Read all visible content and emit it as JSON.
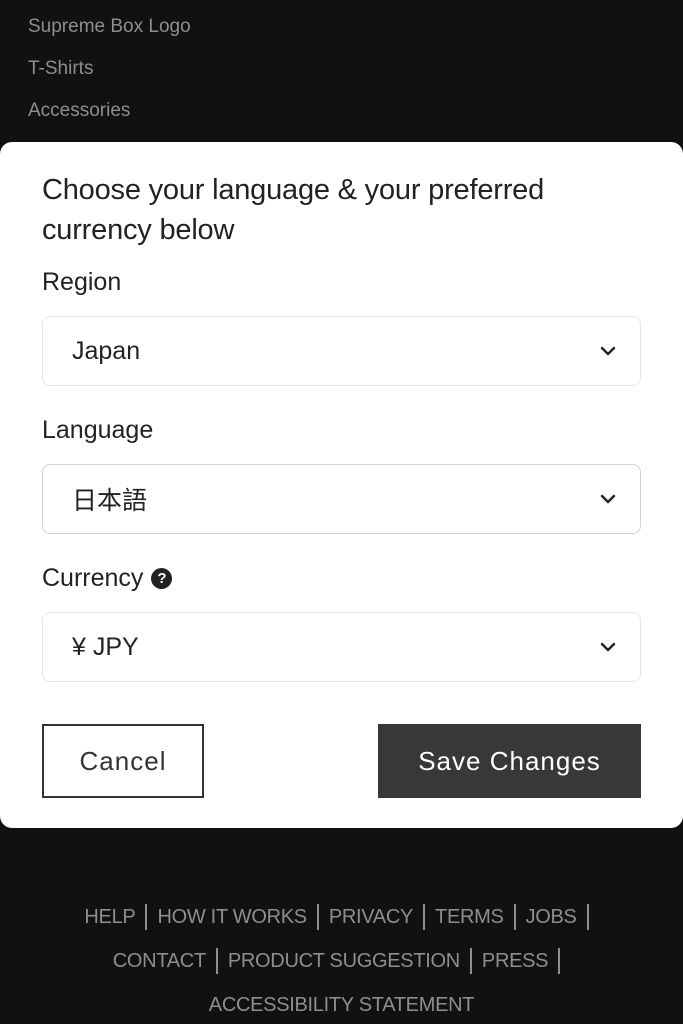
{
  "background_nav": {
    "items": [
      "Supreme Box Logo",
      "T-Shirts",
      "Accessories"
    ]
  },
  "modal": {
    "title": "Choose your language & your preferred currency below",
    "region": {
      "label": "Region",
      "value": "Japan"
    },
    "language": {
      "label": "Language",
      "value": "日本語"
    },
    "currency": {
      "label": "Currency",
      "value": "¥ JPY",
      "help_icon": "question-circle-icon"
    },
    "cancel_label": "Cancel",
    "save_label": "Save Changes"
  },
  "footer": {
    "row1": [
      "HELP",
      "HOW IT WORKS",
      "PRIVACY",
      "TERMS",
      "JOBS"
    ],
    "row2": [
      "CONTACT",
      "PRODUCT SUGGESTION",
      "PRESS"
    ],
    "row3": [
      "ACCESSIBILITY STATEMENT"
    ]
  },
  "colors": {
    "page_bg": "#111111",
    "modal_bg": "#ffffff",
    "primary_button": "#383838",
    "muted_text": "#8e8e8e"
  }
}
